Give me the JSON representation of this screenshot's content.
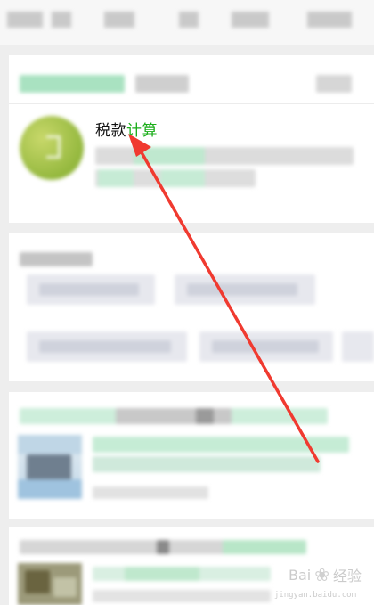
{
  "search_result": {
    "title_part1": "税款",
    "title_part2": "计算"
  },
  "watermark": {
    "icon": "baidu-paw-icon",
    "brand": "Bai",
    "suffix": "经验",
    "sub": "jingyan.baidu.com"
  },
  "colors": {
    "highlight": "#1aad19",
    "annotation_arrow": "#f03a30"
  }
}
